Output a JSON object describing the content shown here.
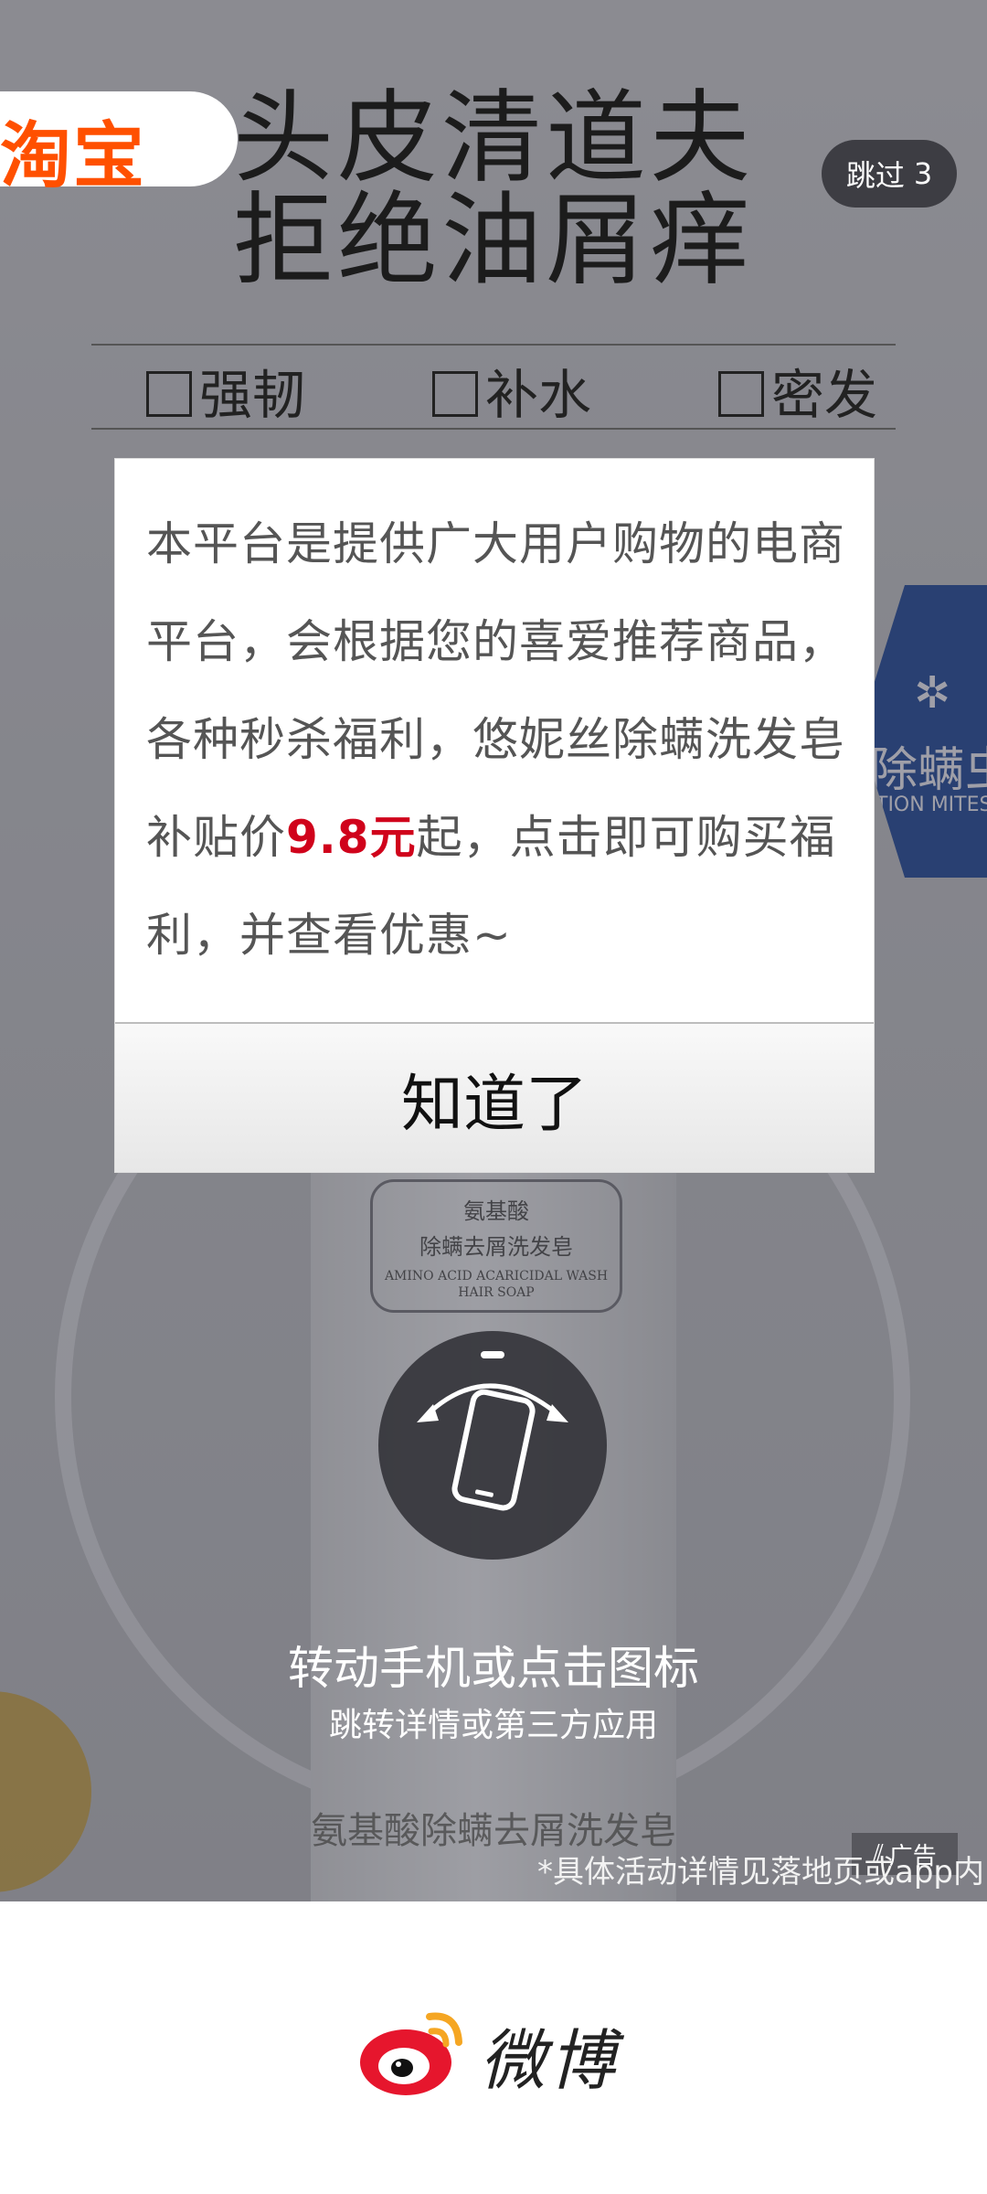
{
  "ad": {
    "platform_tag": "淘宝",
    "headline_line1": "头皮清道夫",
    "headline_line2": "拒绝油屑痒",
    "features": [
      "强韧",
      "补水",
      "密发"
    ],
    "skip_label": "跳过",
    "skip_count": "3",
    "badge_text": "除螨虫",
    "badge_sub": "TION MITES",
    "product_label_cn1": "氨基酸",
    "product_label_cn2": "除螨去屑洗发皂",
    "product_label_en": "AMINO ACID ACARICIDAL WASH HAIR SOAP",
    "rotate_title": "转动手机或点击图标",
    "rotate_sub": "跳转详情或第三方应用",
    "product_name": "氨基酸除螨去屑洗发皂",
    "disclaimer": "*具体活动详情见落地页或app内",
    "ad_badge": "广告"
  },
  "dialog": {
    "body_part1": "本平台是提供广大用户购物的电商平台，会根据您的喜爱推荐商品，各种秒杀福利，悠妮丝除螨洗发皂补贴价",
    "price": "9.8元",
    "body_part2": "起，点击即可购买福利，并查看优惠~",
    "button_label": "知道了",
    "price_color": "#d0021b"
  },
  "brand": {
    "name": "微博",
    "accent": "#e6162d"
  }
}
